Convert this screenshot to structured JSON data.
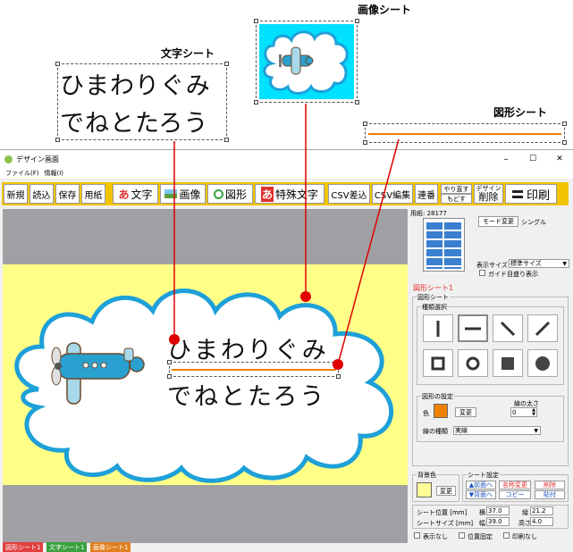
{
  "callouts": {
    "image_sheet": "画像シート",
    "text_sheet": "文字シート",
    "shape_sheet": "図形シート"
  },
  "sample_text": {
    "line1": "ひまわりぐみ",
    "line2": "でねとたろう"
  },
  "window": {
    "title": "デザイン画面",
    "menu": [
      "ファイル(F)",
      "情報(I)"
    ],
    "controls": {
      "minimize": "–",
      "maximize": "☐",
      "close": "✕"
    }
  },
  "toolbar": {
    "new": "新規",
    "load": "読込",
    "save": "保存",
    "paper": "用紙",
    "text": "文字",
    "text_glyph": "あ",
    "image": "画像",
    "shape": "図形",
    "special_text": "特殊文字",
    "special_glyph": "あ",
    "csv_insert": "CSV差込",
    "csv_edit": "CSV編集",
    "serial": "連番",
    "redo": "やり直す",
    "undo": "もどす",
    "delete_top": "デザイン",
    "delete": "削除",
    "print": "印刷"
  },
  "side": {
    "paper_label": "用紙: 28177",
    "mode_change": "モード変更",
    "mode_value": "シングル",
    "display_size_label": "表示サイズ",
    "display_size_value": "標準サイズ",
    "guide_label": "ガイド目盛り表示",
    "current_sheet": "図形シート1",
    "shape_sheet_group": "図形シート",
    "type_group": "種類選択",
    "shape_settings": "図形の設定",
    "color_label": "色",
    "change": "変更",
    "line_width_label": "線の太さ",
    "line_width_value": "0",
    "line_type_label": "線の種類",
    "line_type_value": "実線",
    "bg_color_label": "背景色",
    "bg_change": "変更",
    "sheet_settings": "シート設定",
    "bring_front": "▲前面へ",
    "send_back": "▼背面へ",
    "rename": "名称変更",
    "copy": "コピー",
    "delete": "削除",
    "paste": "貼付",
    "position_label": "シート位置 [mm]",
    "x_label": "横",
    "x_value": "37.0",
    "y_label": "縦",
    "y_value": "21.2",
    "size_label": "シートサイズ [mm]",
    "w_label": "幅",
    "w_value": "39.0",
    "h_label": "高さ",
    "h_value": "4.0",
    "hide_label": "表示なし",
    "lock_label": "位置固定",
    "noprint_label": "印刷なし"
  },
  "sheet_tabs": [
    {
      "label": "図形シート1",
      "color": "#e04040"
    },
    {
      "label": "文字シート1",
      "color": "#3aa040"
    },
    {
      "label": "画像シート1",
      "color": "#e08020"
    }
  ],
  "colors": {
    "toolbar": "#f2c400",
    "canvas_bg": "#ffff88",
    "cloud_border": "#1ea0d8",
    "image_bg": "#00e0ff",
    "shape_color": "#f08000",
    "callout_line": "#e00000",
    "bg_swatch": "#ffff99"
  }
}
